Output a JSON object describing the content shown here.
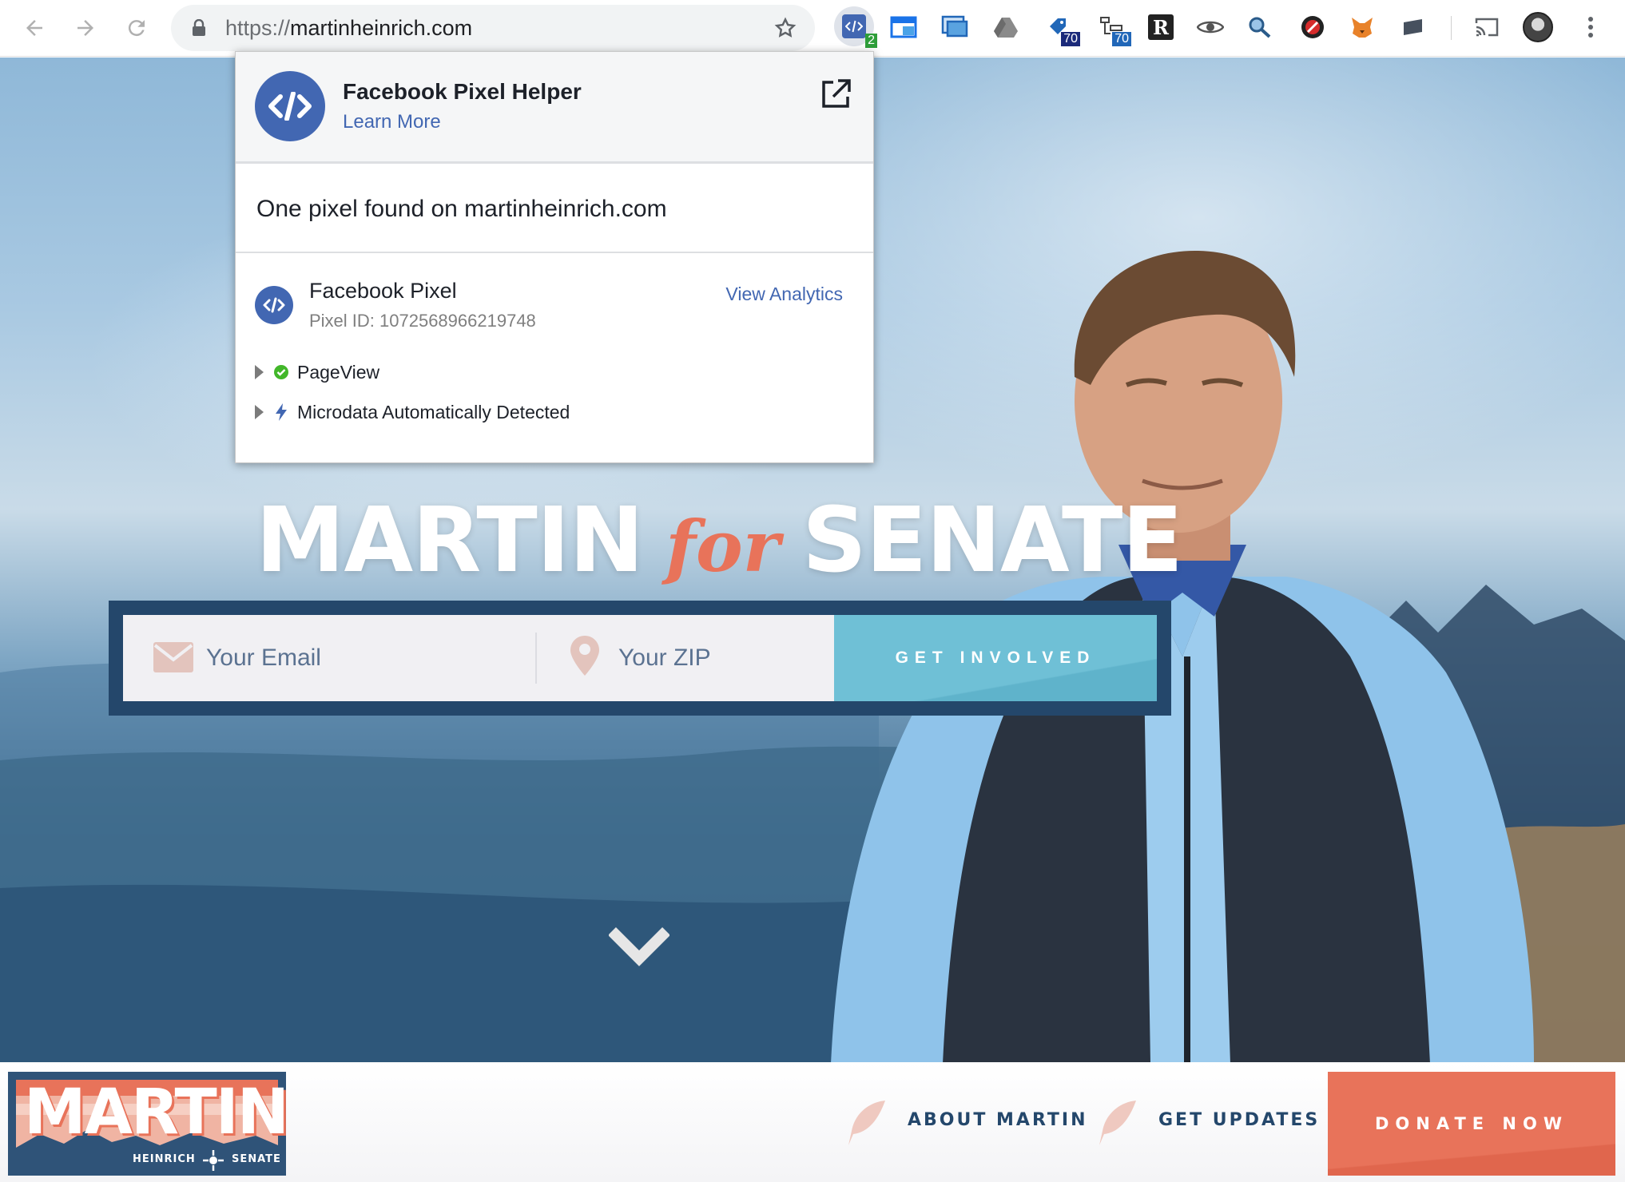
{
  "browser": {
    "url_scheme": "https://",
    "url_host": "martinheinrich.com",
    "extension_badges": {
      "pixel_helper": "2",
      "ext_a": "70",
      "ext_b": "70"
    }
  },
  "popup": {
    "title": "Facebook Pixel Helper",
    "learn_more": "Learn More",
    "summary": "One pixel found on martinheinrich.com",
    "pixel": {
      "name": "Facebook Pixel",
      "id_label": "Pixel ID: 1072568966219748",
      "view_analytics": "View Analytics",
      "events": [
        {
          "label": "PageView",
          "status": "success"
        },
        {
          "label": "Microdata Automatically Detected",
          "status": "info"
        }
      ]
    }
  },
  "hero": {
    "headline_left": "MARTIN",
    "headline_mid": "for",
    "headline_right": "SENATE",
    "email_placeholder": "Your Email",
    "zip_placeholder": "Your ZIP",
    "cta": "GET INVOLVED"
  },
  "footer_nav": {
    "logo_title": "MARTIN",
    "logo_sub_left": "HEINRICH",
    "logo_sub_right": "SENATE",
    "links": [
      "ABOUT MARTIN",
      "GET UPDATES"
    ],
    "donate": "DONATE NOW"
  },
  "colors": {
    "brand_navy": "#24476b",
    "brand_coral": "#e8735a",
    "cta_teal": "#6fc0d6",
    "facebook_blue": "#4267b2"
  },
  "icons": [
    "back-icon",
    "forward-icon",
    "reload-icon",
    "lock-icon",
    "star-icon",
    "kebab-menu-icon",
    "cast-icon",
    "email-icon",
    "location-pin-icon",
    "chevron-down-icon",
    "external-link-icon",
    "check-circle-icon",
    "lightning-icon",
    "feather-icon"
  ]
}
